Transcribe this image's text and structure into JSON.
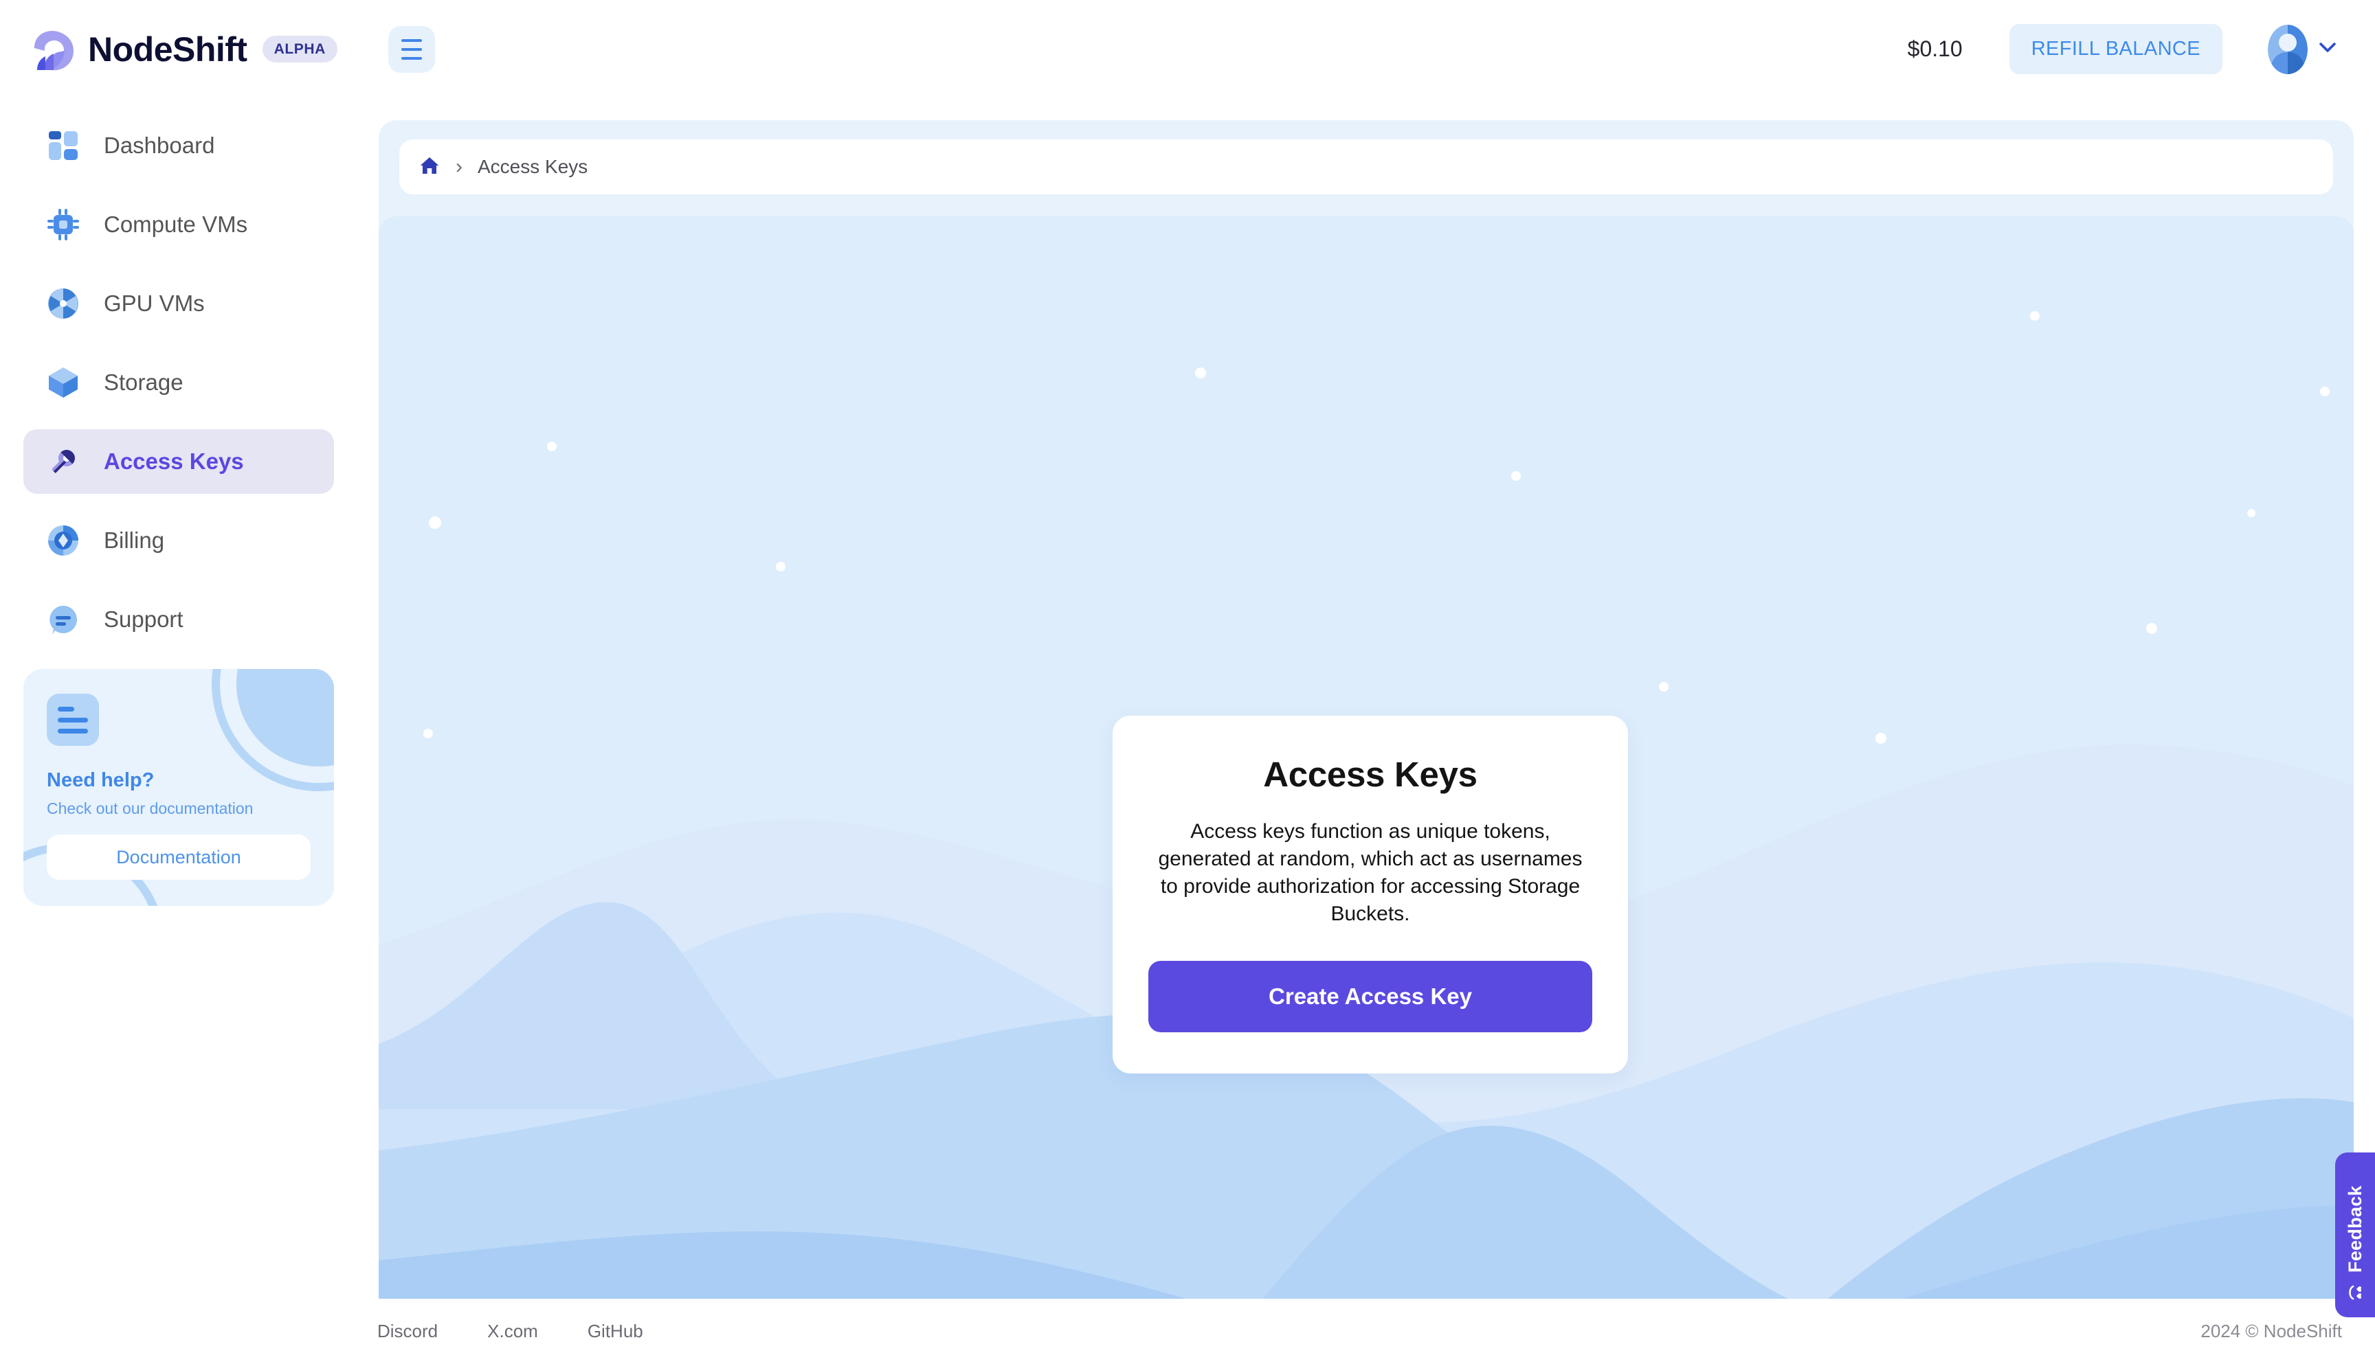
{
  "brand": {
    "name": "NodeShift",
    "badge": "ALPHA",
    "logo_icon": "nodeshift-wave-logo",
    "accent": "#5b4ae0"
  },
  "topbar": {
    "menu_icon": "hamburger-menu-icon",
    "balance": "$0.10",
    "refill_label": "REFILL BALANCE",
    "avatar_icon": "user-avatar-icon",
    "chevron_icon": "chevron-down-icon",
    "refill_color": "#3d8bea"
  },
  "sidebar": {
    "items": [
      {
        "label": "Dashboard",
        "icon": "dashboard-grid-icon",
        "active": false
      },
      {
        "label": "Compute VMs",
        "icon": "cpu-chip-icon",
        "active": false
      },
      {
        "label": "GPU VMs",
        "icon": "gpu-fan-icon",
        "active": false
      },
      {
        "label": "Storage",
        "icon": "storage-cube-icon",
        "active": false
      },
      {
        "label": "Access Keys",
        "icon": "key-icon",
        "active": true
      },
      {
        "label": "Billing",
        "icon": "billing-coin-icon",
        "active": false
      },
      {
        "label": "Support",
        "icon": "support-chat-icon",
        "active": false
      }
    ],
    "help_card": {
      "icon": "document-lines-icon",
      "title": "Need help?",
      "subtitle": "Check out our documentation",
      "button_label": "Documentation"
    }
  },
  "breadcrumb": {
    "home_icon": "home-icon",
    "separator": "›",
    "current": "Access Keys"
  },
  "hero": {
    "card": {
      "title": "Access Keys",
      "description": "Access keys function as unique tokens, generated at random, which act as usernames to provide authorization for accessing Storage Buckets.",
      "cta_label": "Create Access Key"
    },
    "background": {
      "style": "night-sky-with-crescent-and-mountain-waves",
      "base_color": "#ddedfc",
      "crescent_color": "#c3ddfb",
      "star_color": "#ffffff"
    }
  },
  "feedback_tab": {
    "label": "Feedback",
    "icon": "smiley-hearts-icon",
    "color": "#5b4ae0"
  },
  "footer": {
    "links": [
      "Discord",
      "X.com",
      "GitHub"
    ],
    "copyright": "2024 © NodeShift"
  }
}
